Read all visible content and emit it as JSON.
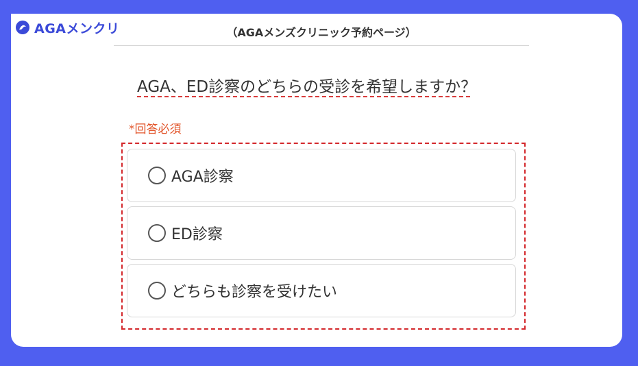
{
  "logo": {
    "text": "AGAメンクリ"
  },
  "header": {
    "title": "（AGAメンズクリニック予約ページ）"
  },
  "question": {
    "text": "AGA、ED診察のどちらの受診を希望しますか？"
  },
  "form": {
    "required_label": "*回答必須",
    "options": [
      {
        "label": "AGA診察",
        "selected": false
      },
      {
        "label": "ED診察",
        "selected": false
      },
      {
        "label": "どちらも診察を受けたい",
        "selected": false
      }
    ]
  },
  "colors": {
    "background": "#4f5ff0",
    "brand": "#3b4ad8",
    "required": "#e2552b",
    "highlight_border": "#d3272b"
  }
}
